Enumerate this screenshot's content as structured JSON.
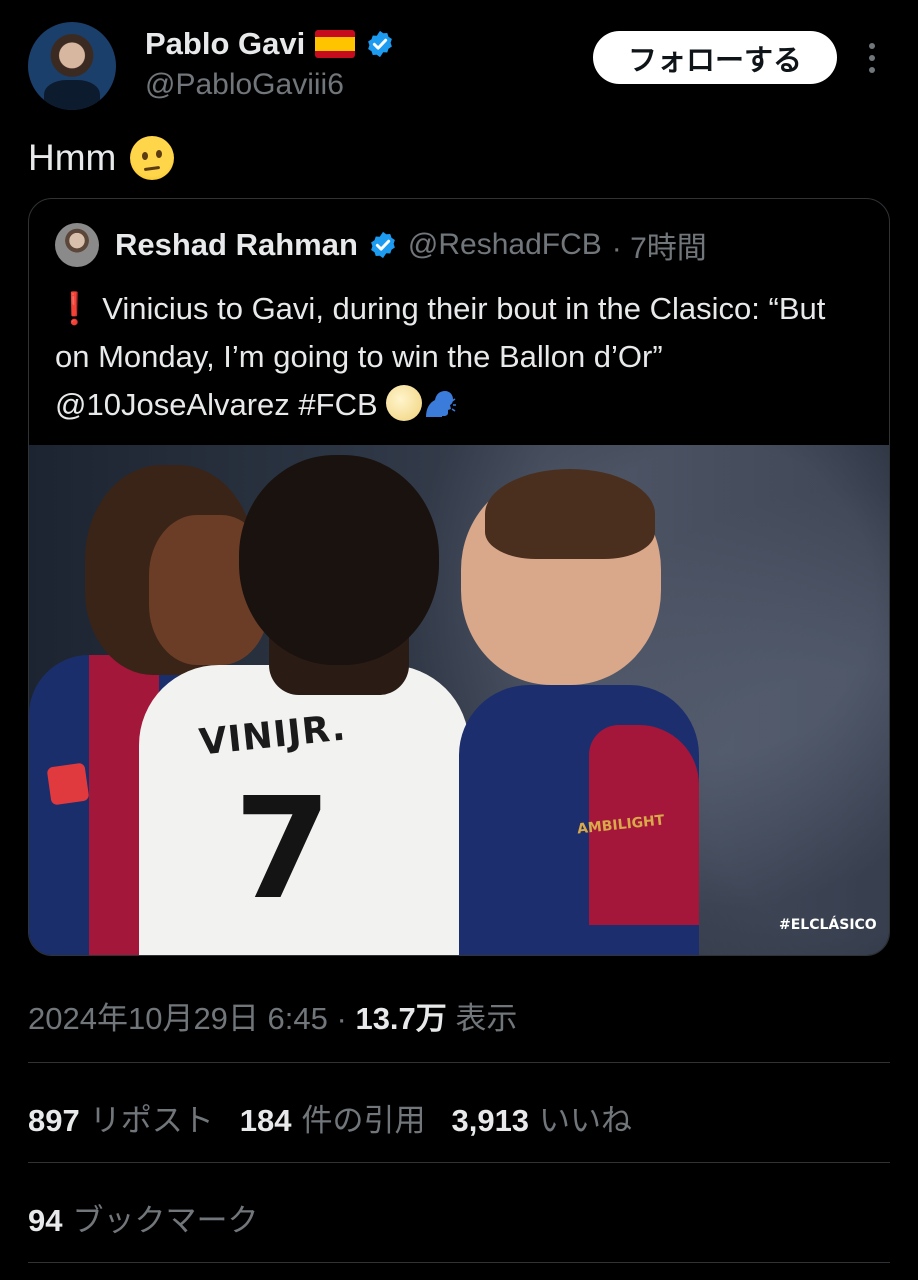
{
  "author": {
    "name": "Pablo Gavi",
    "flag": "spain-flag-icon",
    "verified_icon": "verified-badge-icon",
    "handle": "@PabloGaviii6"
  },
  "follow_button_label": "フォローする",
  "more_icon": "more-dots-icon",
  "tweet": {
    "text": "Hmm",
    "emoji": "face-with-raised-eyebrow-emoji"
  },
  "quoted": {
    "name": "Reshad Rahman",
    "handle": "@ReshadFCB",
    "time": "· 7時間",
    "text_excl": "❗",
    "text_body": "Vinicius to Gavi, during their bout in the Clasico: “But on Monday, I’m going to win the Ballon d’Or” @10JoseAlvarez #FCB",
    "image_jersey_name": "VINIJR.",
    "image_jersey_number": "7",
    "image_sponsor": "AMBILIGHT",
    "image_hashtag": "#ELCLÁSICO"
  },
  "meta": {
    "datetime": "2024年10月29日 6:45",
    "separator": "·",
    "views_count": "13.7万",
    "views_label": "表示"
  },
  "stats": {
    "reposts_count": "897",
    "reposts_label": "リポスト",
    "quotes_count": "184",
    "quotes_label": "件の引用",
    "likes_count": "3,913",
    "likes_label": "いいね",
    "bookmarks_count": "94",
    "bookmarks_label": "ブックマーク"
  },
  "colors": {
    "background": "#000000",
    "text": "#e7e9ea",
    "secondary": "#71767b",
    "verified": "#1d9bf0",
    "divider": "#2f3336"
  }
}
